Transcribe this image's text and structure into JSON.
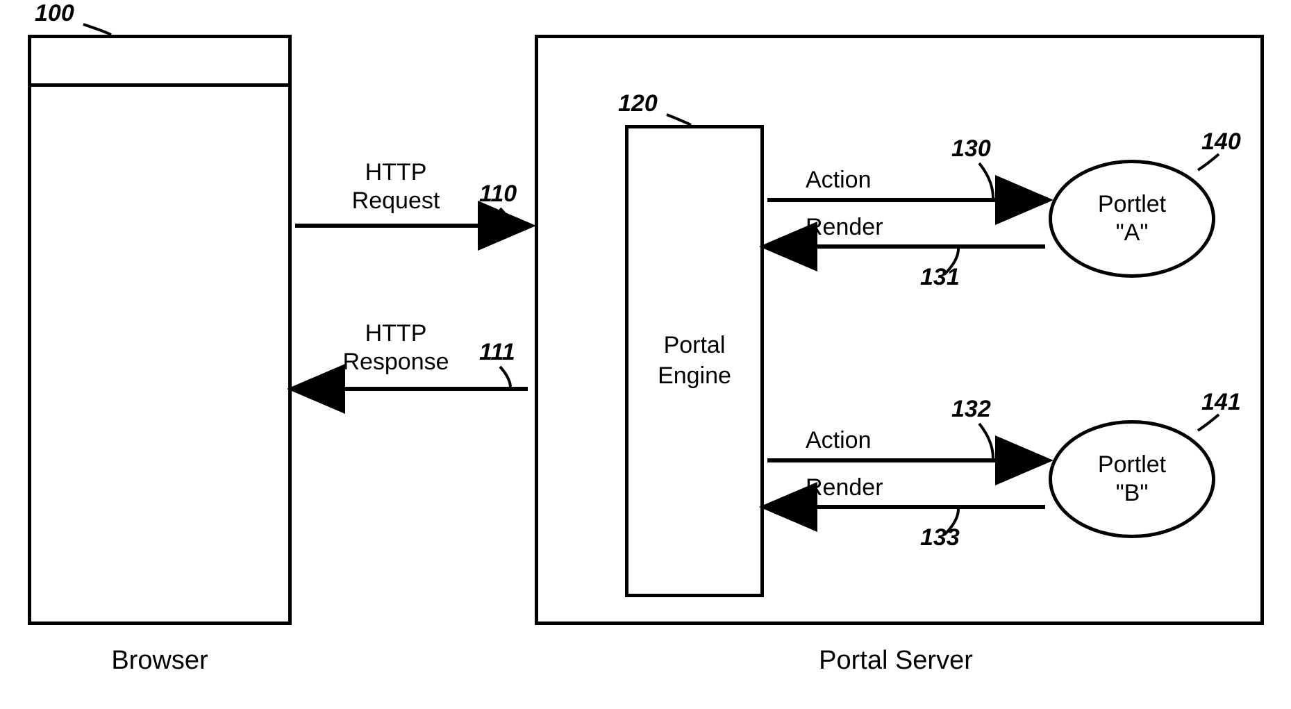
{
  "refs": {
    "browser": "100",
    "http_request": "110",
    "http_response": "111",
    "portal_engine": "120",
    "action_a": "130",
    "render_a": "131",
    "action_b": "132",
    "render_b": "133",
    "portlet_a": "140",
    "portlet_b": "141"
  },
  "labels": {
    "browser": "Browser",
    "portal_server": "Portal Server",
    "portal_engine": "Portal\nEngine",
    "http_request_l1": "HTTP",
    "http_request_l2": "Request",
    "http_response_l1": "HTTP",
    "http_response_l2": "Response",
    "action": "Action",
    "render": "Render",
    "portlet_a_l1": "Portlet",
    "portlet_a_l2": "\"A\"",
    "portlet_b_l1": "Portlet",
    "portlet_b_l2": "\"B\""
  }
}
